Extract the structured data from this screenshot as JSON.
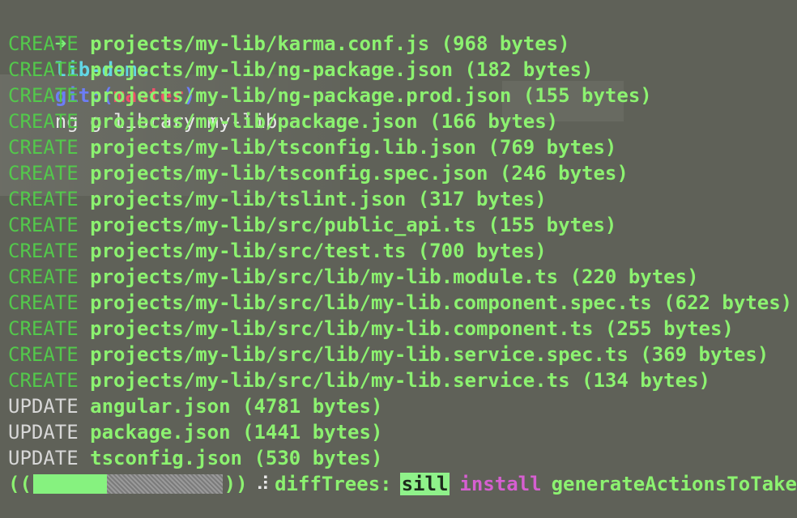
{
  "prompt": {
    "arrow": "➜",
    "dir": "lib-demo",
    "git_label": "git:",
    "paren_open": "(",
    "branch": "master",
    "paren_close": ")",
    "command": "ng g library my-lib"
  },
  "output": [
    {
      "action": "CREATE",
      "text": "projects/my-lib/karma.conf.js (968 bytes)"
    },
    {
      "action": "CREATE",
      "text": "projects/my-lib/ng-package.json (182 bytes)"
    },
    {
      "action": "CREATE",
      "text": "projects/my-lib/ng-package.prod.json (155 bytes)"
    },
    {
      "action": "CREATE",
      "text": "projects/my-lib/package.json (166 bytes)"
    },
    {
      "action": "CREATE",
      "text": "projects/my-lib/tsconfig.lib.json (769 bytes)"
    },
    {
      "action": "CREATE",
      "text": "projects/my-lib/tsconfig.spec.json (246 bytes)"
    },
    {
      "action": "CREATE",
      "text": "projects/my-lib/tslint.json (317 bytes)"
    },
    {
      "action": "CREATE",
      "text": "projects/my-lib/src/public_api.ts (155 bytes)"
    },
    {
      "action": "CREATE",
      "text": "projects/my-lib/src/test.ts (700 bytes)"
    },
    {
      "action": "CREATE",
      "text": "projects/my-lib/src/lib/my-lib.module.ts (220 bytes)"
    },
    {
      "action": "CREATE",
      "text": "projects/my-lib/src/lib/my-lib.component.spec.ts (622 bytes)"
    },
    {
      "action": "CREATE",
      "text": "projects/my-lib/src/lib/my-lib.component.ts (255 bytes)"
    },
    {
      "action": "CREATE",
      "text": "projects/my-lib/src/lib/my-lib.service.spec.ts (369 bytes)"
    },
    {
      "action": "CREATE",
      "text": "projects/my-lib/src/lib/my-lib.service.ts (134 bytes)"
    },
    {
      "action": "UPDATE",
      "text": "angular.json (4781 bytes)"
    },
    {
      "action": "UPDATE",
      "text": "package.json (1441 bytes)"
    },
    {
      "action": "UPDATE",
      "text": "tsconfig.json (530 bytes)"
    }
  ],
  "progress": {
    "open": "((",
    "close": "))",
    "fraction": 0.39,
    "spinner": "⠼",
    "label": "diffTrees:",
    "level": "sill",
    "stage": "install",
    "task": "generateActionsToTake"
  },
  "colors": {
    "background": "#5f6158",
    "create": "#53c94b",
    "path": "#8cf270",
    "update": "#d7d7d7",
    "branch": "#f0506a",
    "dir": "#62d7e6"
  }
}
